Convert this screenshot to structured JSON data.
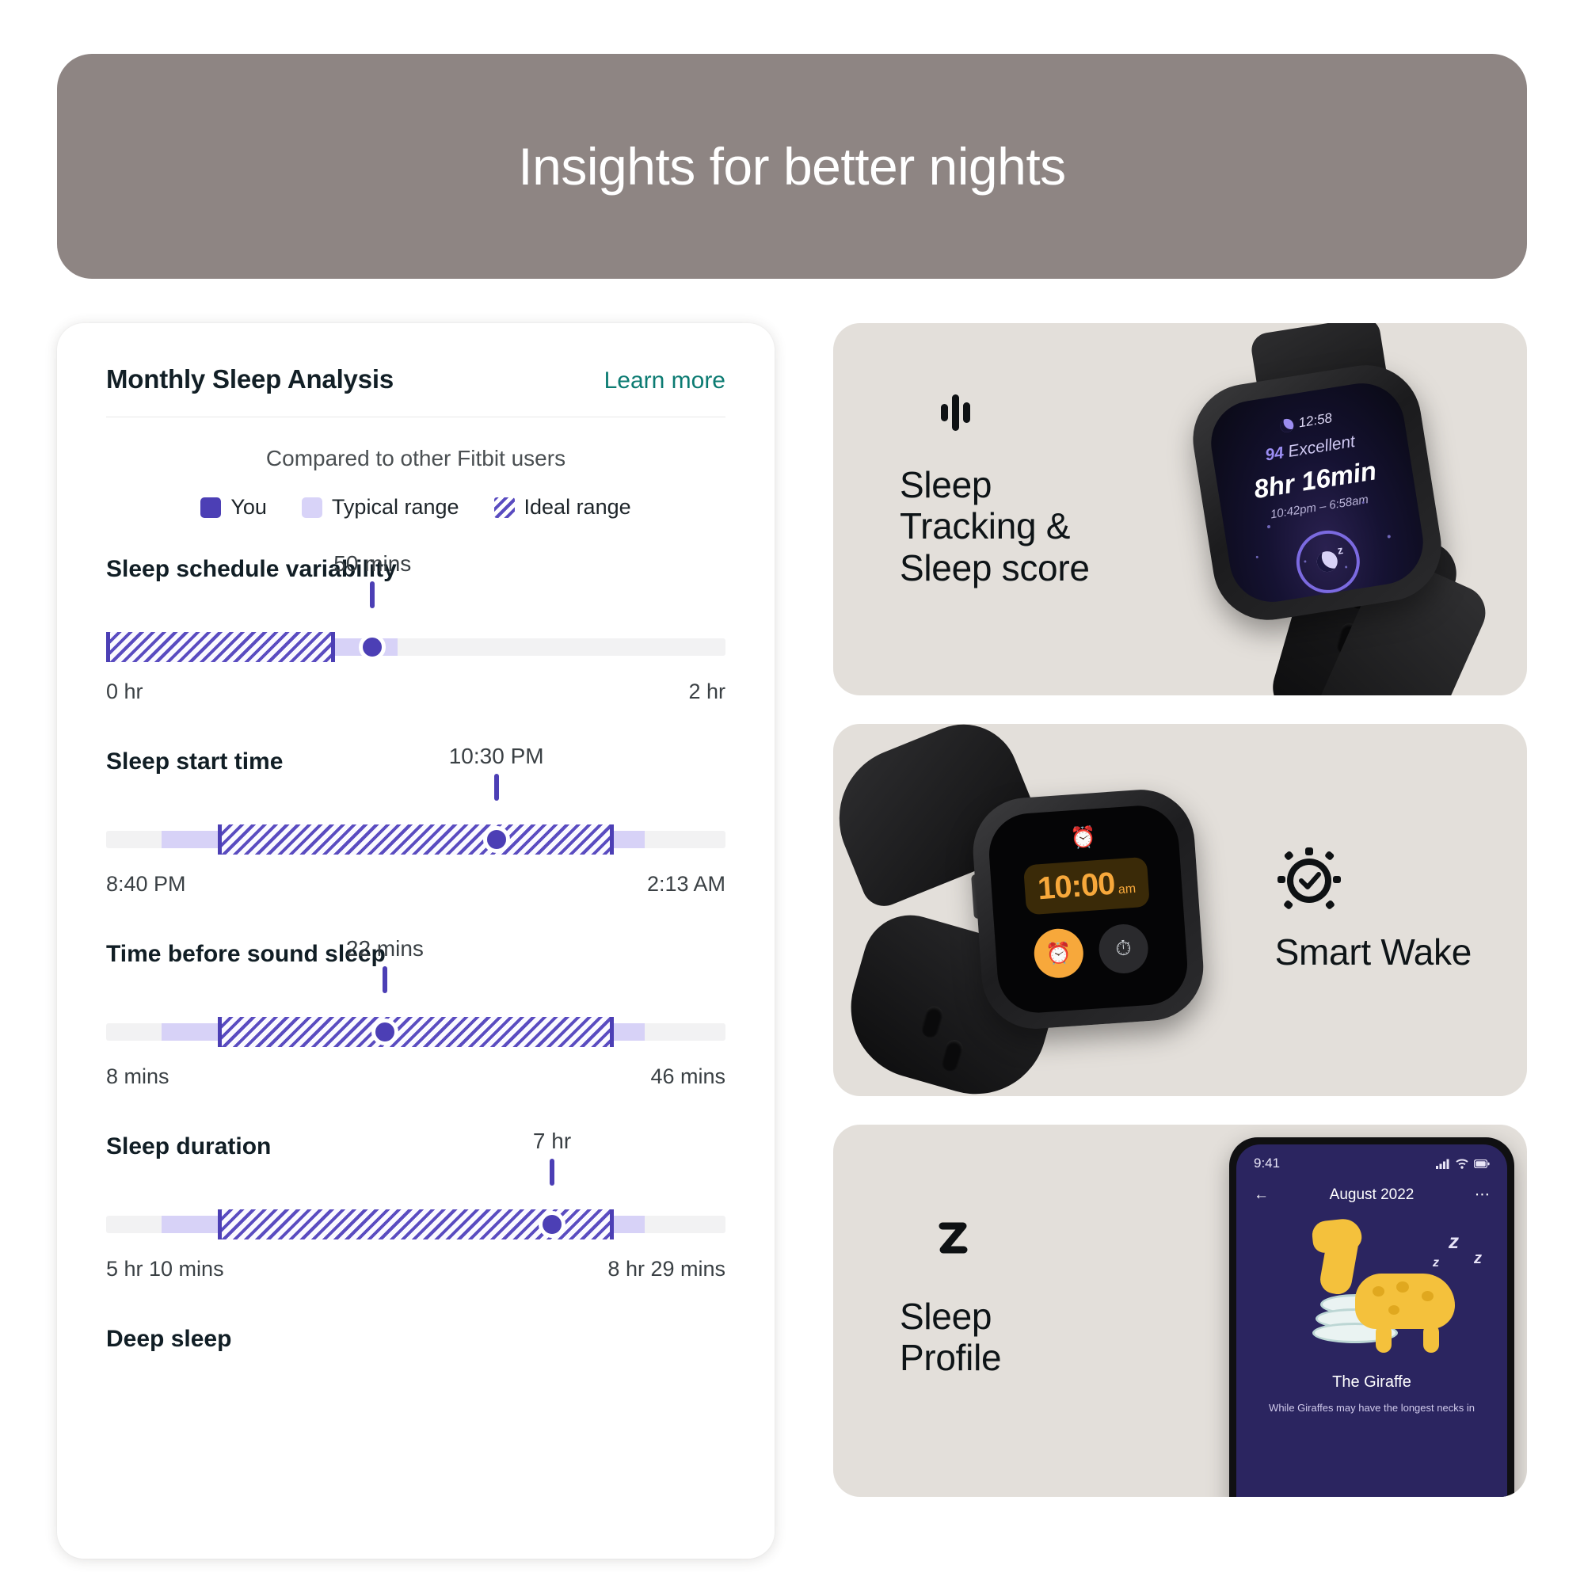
{
  "hero": {
    "title": "Insights for better nights"
  },
  "analysis": {
    "title": "Monthly Sleep Analysis",
    "learn_more": "Learn more",
    "compare_note": "Compared to other Fitbit users",
    "legend": [
      {
        "label": "You",
        "swatch": "solid",
        "color": "#4c3fb5",
        "icon": "square-swatch-icon"
      },
      {
        "label": "Typical range",
        "swatch": "solid",
        "color": "#d8d3f8",
        "icon": "square-swatch-icon"
      },
      {
        "label": "Ideal range",
        "swatch": "hatched",
        "color": "#5a4cc0",
        "icon": "hatched-swatch-icon"
      }
    ]
  },
  "chart_data": {
    "type": "bar",
    "title": "Monthly Sleep Analysis",
    "subtitle": "Compared to other Fitbit users",
    "legend": [
      "You",
      "Typical range",
      "Ideal range"
    ],
    "legend_position": "top-center",
    "grid": false,
    "metrics": [
      {
        "name": "Sleep schedule variability",
        "axis_min_label": "0 hr",
        "axis_max_label": "2 hr",
        "value_label": "50 mins",
        "value_pct": 43,
        "typical_start_pct": 0,
        "typical_end_pct": 47,
        "ideal_start_pct": 0,
        "ideal_end_pct": 37
      },
      {
        "name": "Sleep start time",
        "axis_min_label": "8:40 PM",
        "axis_max_label": "2:13 AM",
        "value_label": "10:30 PM",
        "value_pct": 63,
        "typical_start_pct": 9,
        "typical_end_pct": 87,
        "ideal_start_pct": 18,
        "ideal_end_pct": 82
      },
      {
        "name": "Time before sound sleep",
        "axis_min_label": "8 mins",
        "axis_max_label": "46 mins",
        "value_label": "22 mins",
        "value_pct": 45,
        "typical_start_pct": 9,
        "typical_end_pct": 87,
        "ideal_start_pct": 18,
        "ideal_end_pct": 82
      },
      {
        "name": "Sleep duration",
        "axis_min_label": "5 hr 10 mins",
        "axis_max_label": "8 hr 29 mins",
        "value_label": "7 hr",
        "value_pct": 72,
        "typical_start_pct": 9,
        "typical_end_pct": 87,
        "ideal_start_pct": 18,
        "ideal_end_pct": 82
      },
      {
        "name": "Deep sleep",
        "axis_min_label": "",
        "axis_max_label": "",
        "value_label": "",
        "value_pct": null,
        "typical_start_pct": null,
        "typical_end_pct": null,
        "ideal_start_pct": null,
        "ideal_end_pct": null
      }
    ]
  },
  "promos": [
    {
      "icon": "moon-soundwave-icon",
      "heading_line1": "Sleep",
      "heading_line2": "Tracking &",
      "heading_line3": "Sleep score",
      "device": {
        "type": "smartwatch",
        "screen": {
          "clock": "12:58",
          "score": "94",
          "score_word": "Excellent",
          "duration": "8hr 16min",
          "range": "10:42pm – 6:58am"
        }
      }
    },
    {
      "icon": "alarm-clock-icon",
      "heading_line1": "Smart Wake",
      "device": {
        "type": "smartwatch",
        "screen": {
          "time": "10:00",
          "ampm": "am",
          "bell_icon": "alarm-bell-icon",
          "confirm_icon": "alarm-on-icon",
          "dismiss_icon": "alarm-off-icon"
        }
      }
    },
    {
      "icon": "moon-z-icon",
      "heading_line1": "Sleep",
      "heading_line2": "Profile",
      "device": {
        "type": "phone",
        "screen": {
          "status_time": "9:41",
          "status_icons": "signal-wifi-battery-icon",
          "back_icon": "back-arrow-icon",
          "month": "August 2022",
          "more_icon": "more-options-icon",
          "animal": "The Giraffe",
          "description": "While Giraffes may have the longest necks in",
          "zzz": "z"
        }
      }
    }
  ],
  "colors": {
    "hero_bg": "#8e8583",
    "card_bg": "#ffffff",
    "promo_bg": "#e3dfda",
    "accent_purple": "#4c3fb5",
    "typical_purple": "#d7d2f7",
    "track_gray": "#f2f2f3",
    "link_teal": "#0b7b72",
    "title_dark": "#121f26"
  }
}
